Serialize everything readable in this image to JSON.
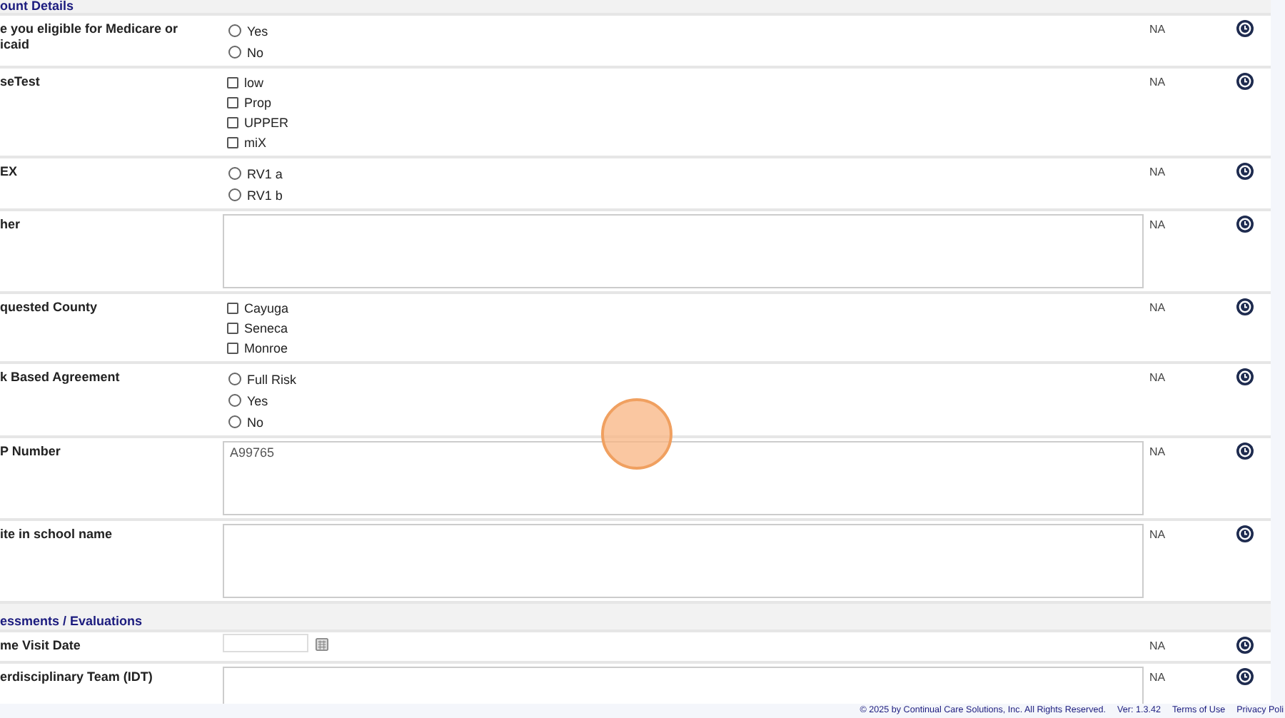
{
  "sections": [
    {
      "title": "ount Details",
      "rows": [
        {
          "label": "e you eligible for Medicare or icaid",
          "kind": "radio",
          "options": [
            {
              "label": "Yes",
              "selected": false
            },
            {
              "label": "No",
              "selected": false
            }
          ],
          "status": "NA"
        },
        {
          "label": "seTest",
          "kind": "checkbox",
          "options": [
            {
              "label": "low",
              "checked": false
            },
            {
              "label": "Prop",
              "checked": false
            },
            {
              "label": "UPPER",
              "checked": false
            },
            {
              "label": "miX",
              "checked": false
            }
          ],
          "status": "NA"
        },
        {
          "label": "EX",
          "kind": "radio",
          "options": [
            {
              "label": "RV1 a",
              "selected": false
            },
            {
              "label": "RV1 b",
              "selected": false
            }
          ],
          "status": "NA"
        },
        {
          "label": "her",
          "kind": "textarea",
          "status": "NA"
        },
        {
          "label": "quested County",
          "kind": "checkbox",
          "options": [
            {
              "label": "Cayuga",
              "checked": false
            },
            {
              "label": "Seneca",
              "checked": false
            },
            {
              "label": "Monroe",
              "checked": false
            }
          ],
          "status": "NA"
        },
        {
          "label": "k Based Agreement",
          "kind": "radio",
          "options": [
            {
              "label": "Full Risk",
              "selected": false
            },
            {
              "label": "Yes",
              "selected": false
            },
            {
              "label": "No",
              "selected": false
            }
          ],
          "status": "NA"
        },
        {
          "label": "P Number",
          "kind": "textarea",
          "value": "A99765",
          "status": "NA"
        },
        {
          "label": "ite in school name",
          "kind": "textarea",
          "status": "NA"
        }
      ]
    },
    {
      "title": "essments / Evaluations",
      "rows": [
        {
          "label": "me Visit Date",
          "kind": "date",
          "status": "NA"
        },
        {
          "label": "erdisciplinary Team (IDT)",
          "kind": "textarea",
          "status": "NA"
        },
        {
          "kind": "cut_off"
        }
      ]
    }
  ],
  "footer": {
    "copyright": "© 2025 by Continual Care Solutions, Inc. All Rights Reserved.",
    "version": "Ver: 1.3.42",
    "links": [
      "Terms of Use",
      "Privacy Poli"
    ]
  }
}
